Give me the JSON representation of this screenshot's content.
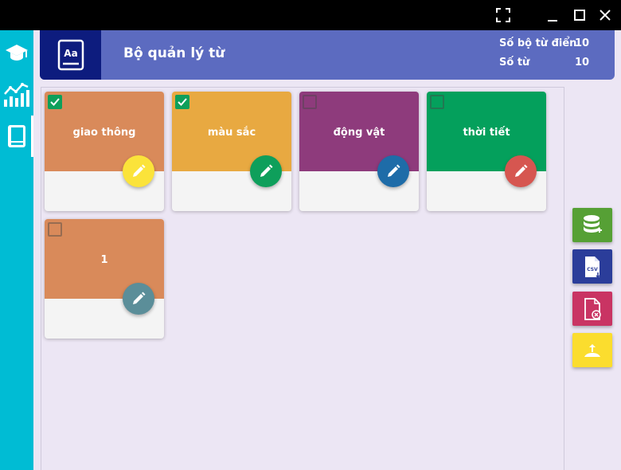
{
  "header": {
    "title": "Bộ quản lý từ",
    "stats": [
      {
        "label": "Số bộ từ điển",
        "value": "10"
      },
      {
        "label": "Số từ",
        "value": "10"
      }
    ]
  },
  "cards": [
    {
      "title": "giao thông",
      "checked": true,
      "color": "#d98a5a",
      "edit_color": "#fbe33a"
    },
    {
      "title": "màu sắc",
      "checked": true,
      "color": "#e8a941",
      "edit_color": "#0e9f5b"
    },
    {
      "title": "động vật",
      "checked": false,
      "color": "#8e3b7c",
      "edit_color": "#1e6ca8"
    },
    {
      "title": "thời tiết",
      "checked": false,
      "color": "#04a05c",
      "edit_color": "#d65650"
    },
    {
      "title": "1",
      "checked": false,
      "color": "#d98a5a",
      "edit_color": "#5b8e99"
    }
  ],
  "actions": [
    {
      "name": "add-database-button",
      "icon": "database-add-icon",
      "color": "#56a035"
    },
    {
      "name": "import-csv-button",
      "icon": "csv-file-icon",
      "color": "#2b3d9a"
    },
    {
      "name": "delete-file-button",
      "icon": "file-delete-icon",
      "color": "#c93463"
    },
    {
      "name": "share-button",
      "icon": "share-user-icon",
      "color": "#fbdd2e"
    }
  ],
  "sidebar": [
    "graduation-cap-icon",
    "chart-icon",
    "book-icon"
  ]
}
